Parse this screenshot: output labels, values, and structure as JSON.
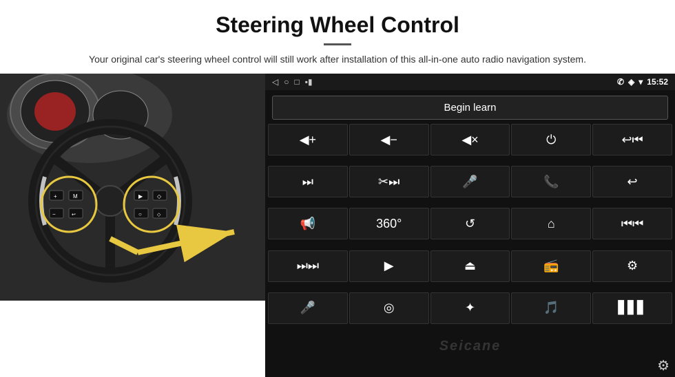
{
  "header": {
    "title": "Steering Wheel Control",
    "subtitle": "Your original car's steering wheel control will still work after installation of this all-in-one auto radio navigation system."
  },
  "android": {
    "statusbar": {
      "nav_back": "◁",
      "nav_home": "○",
      "nav_recent": "□",
      "signal_icon": "▪▪",
      "phone_icon": "📞",
      "location_icon": "◈",
      "wifi_icon": "▾",
      "time": "15:52"
    },
    "begin_learn_label": "Begin learn",
    "controls": [
      {
        "icon": "🔊+",
        "name": "vol-up"
      },
      {
        "icon": "🔊−",
        "name": "vol-down"
      },
      {
        "icon": "🔇",
        "name": "mute"
      },
      {
        "icon": "⏻",
        "name": "power"
      },
      {
        "icon": "⏮",
        "name": "prev-track-phone"
      },
      {
        "icon": "⏭",
        "name": "next-track"
      },
      {
        "icon": "⏭⏭",
        "name": "fast-forward"
      },
      {
        "icon": "🎤",
        "name": "mic"
      },
      {
        "icon": "📞",
        "name": "call"
      },
      {
        "icon": "↩",
        "name": "hang-up"
      },
      {
        "icon": "📢",
        "name": "horn"
      },
      {
        "icon": "360°",
        "name": "camera-360"
      },
      {
        "icon": "↩",
        "name": "back"
      },
      {
        "icon": "⌂",
        "name": "home"
      },
      {
        "icon": "⏮⏮",
        "name": "rewind"
      },
      {
        "icon": "⏭",
        "name": "skip-forward"
      },
      {
        "icon": "▶",
        "name": "navigate"
      },
      {
        "icon": "⏏",
        "name": "eject"
      },
      {
        "icon": "📻",
        "name": "radio"
      },
      {
        "icon": "⚙",
        "name": "settings-eq"
      },
      {
        "icon": "🎙",
        "name": "voice"
      },
      {
        "icon": "⊕",
        "name": "menu"
      },
      {
        "icon": "✱",
        "name": "bluetooth"
      },
      {
        "icon": "♪",
        "name": "music"
      },
      {
        "icon": "📊",
        "name": "equalizer"
      }
    ],
    "seicane_watermark": "Seicane",
    "gear_icon": "⚙"
  }
}
